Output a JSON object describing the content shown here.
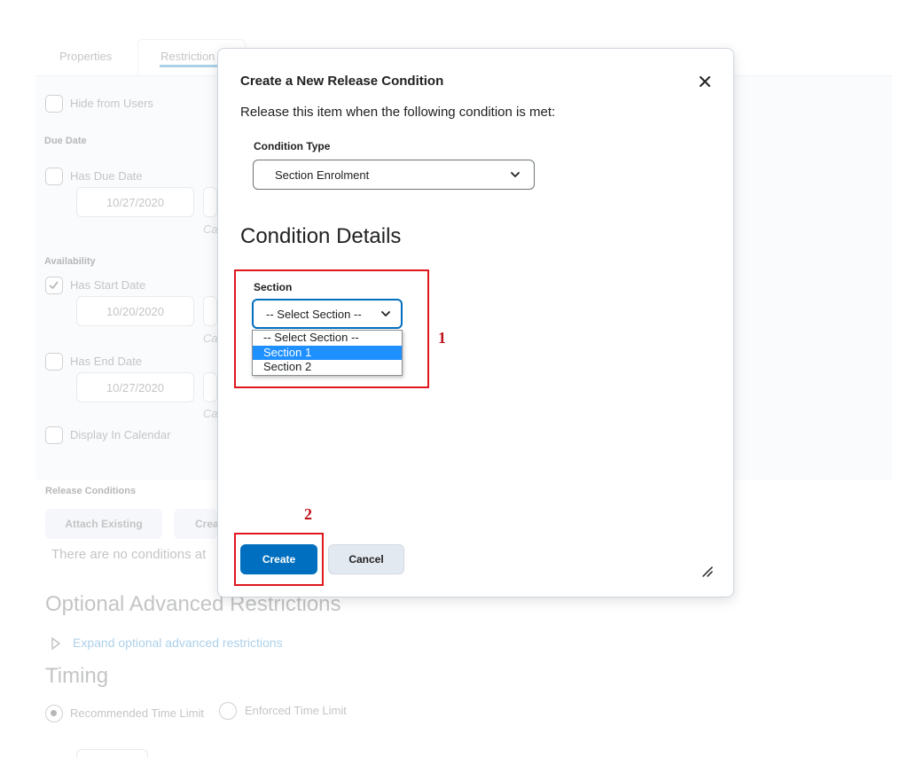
{
  "background": {
    "tabs": [
      "Properties",
      "Restriction"
    ],
    "hide_from_users": "Hide from Users",
    "due_date": {
      "heading": "Due Date",
      "checkbox_label": "Has Due Date",
      "date_value": "10/27/2020",
      "hint": "Ca"
    },
    "availability": {
      "heading": "Availability",
      "start_label": "Has Start Date",
      "start_date": "10/20/2020",
      "start_hint": "Ca",
      "end_label": "Has End Date",
      "end_date": "10/27/2020",
      "end_hint": "Ca"
    },
    "display_in_calendar": "Display In Calendar",
    "release_conditions": {
      "heading": "Release Conditions",
      "attach_existing": "Attach Existing",
      "create_new": "Crea",
      "empty_text": "There are no conditions at"
    },
    "optional_advanced": {
      "heading": "Optional Advanced Restrictions",
      "expand_link": "Expand optional advanced restrictions"
    },
    "timing": {
      "heading": "Timing",
      "recommended": "Recommended Time Limit",
      "enforced": "Enforced Time Limit"
    }
  },
  "dialog": {
    "title": "Create a New Release Condition",
    "subtitle": "Release this item when the following condition is met:",
    "condition_type": {
      "label": "Condition Type",
      "value": "Section Enrolment"
    },
    "details_heading": "Condition Details",
    "section": {
      "label": "Section",
      "value": "-- Select Section --",
      "options": [
        "-- Select Section --",
        "Section 1",
        "Section 2"
      ],
      "highlighted": "Section 1"
    },
    "create_label": "Create",
    "cancel_label": "Cancel"
  },
  "annotations": {
    "marker_1": "1",
    "marker_2": "2",
    "color": "#e0161e"
  },
  "colors": {
    "primary": "#006fbf",
    "highlight": "#1e90ff"
  }
}
